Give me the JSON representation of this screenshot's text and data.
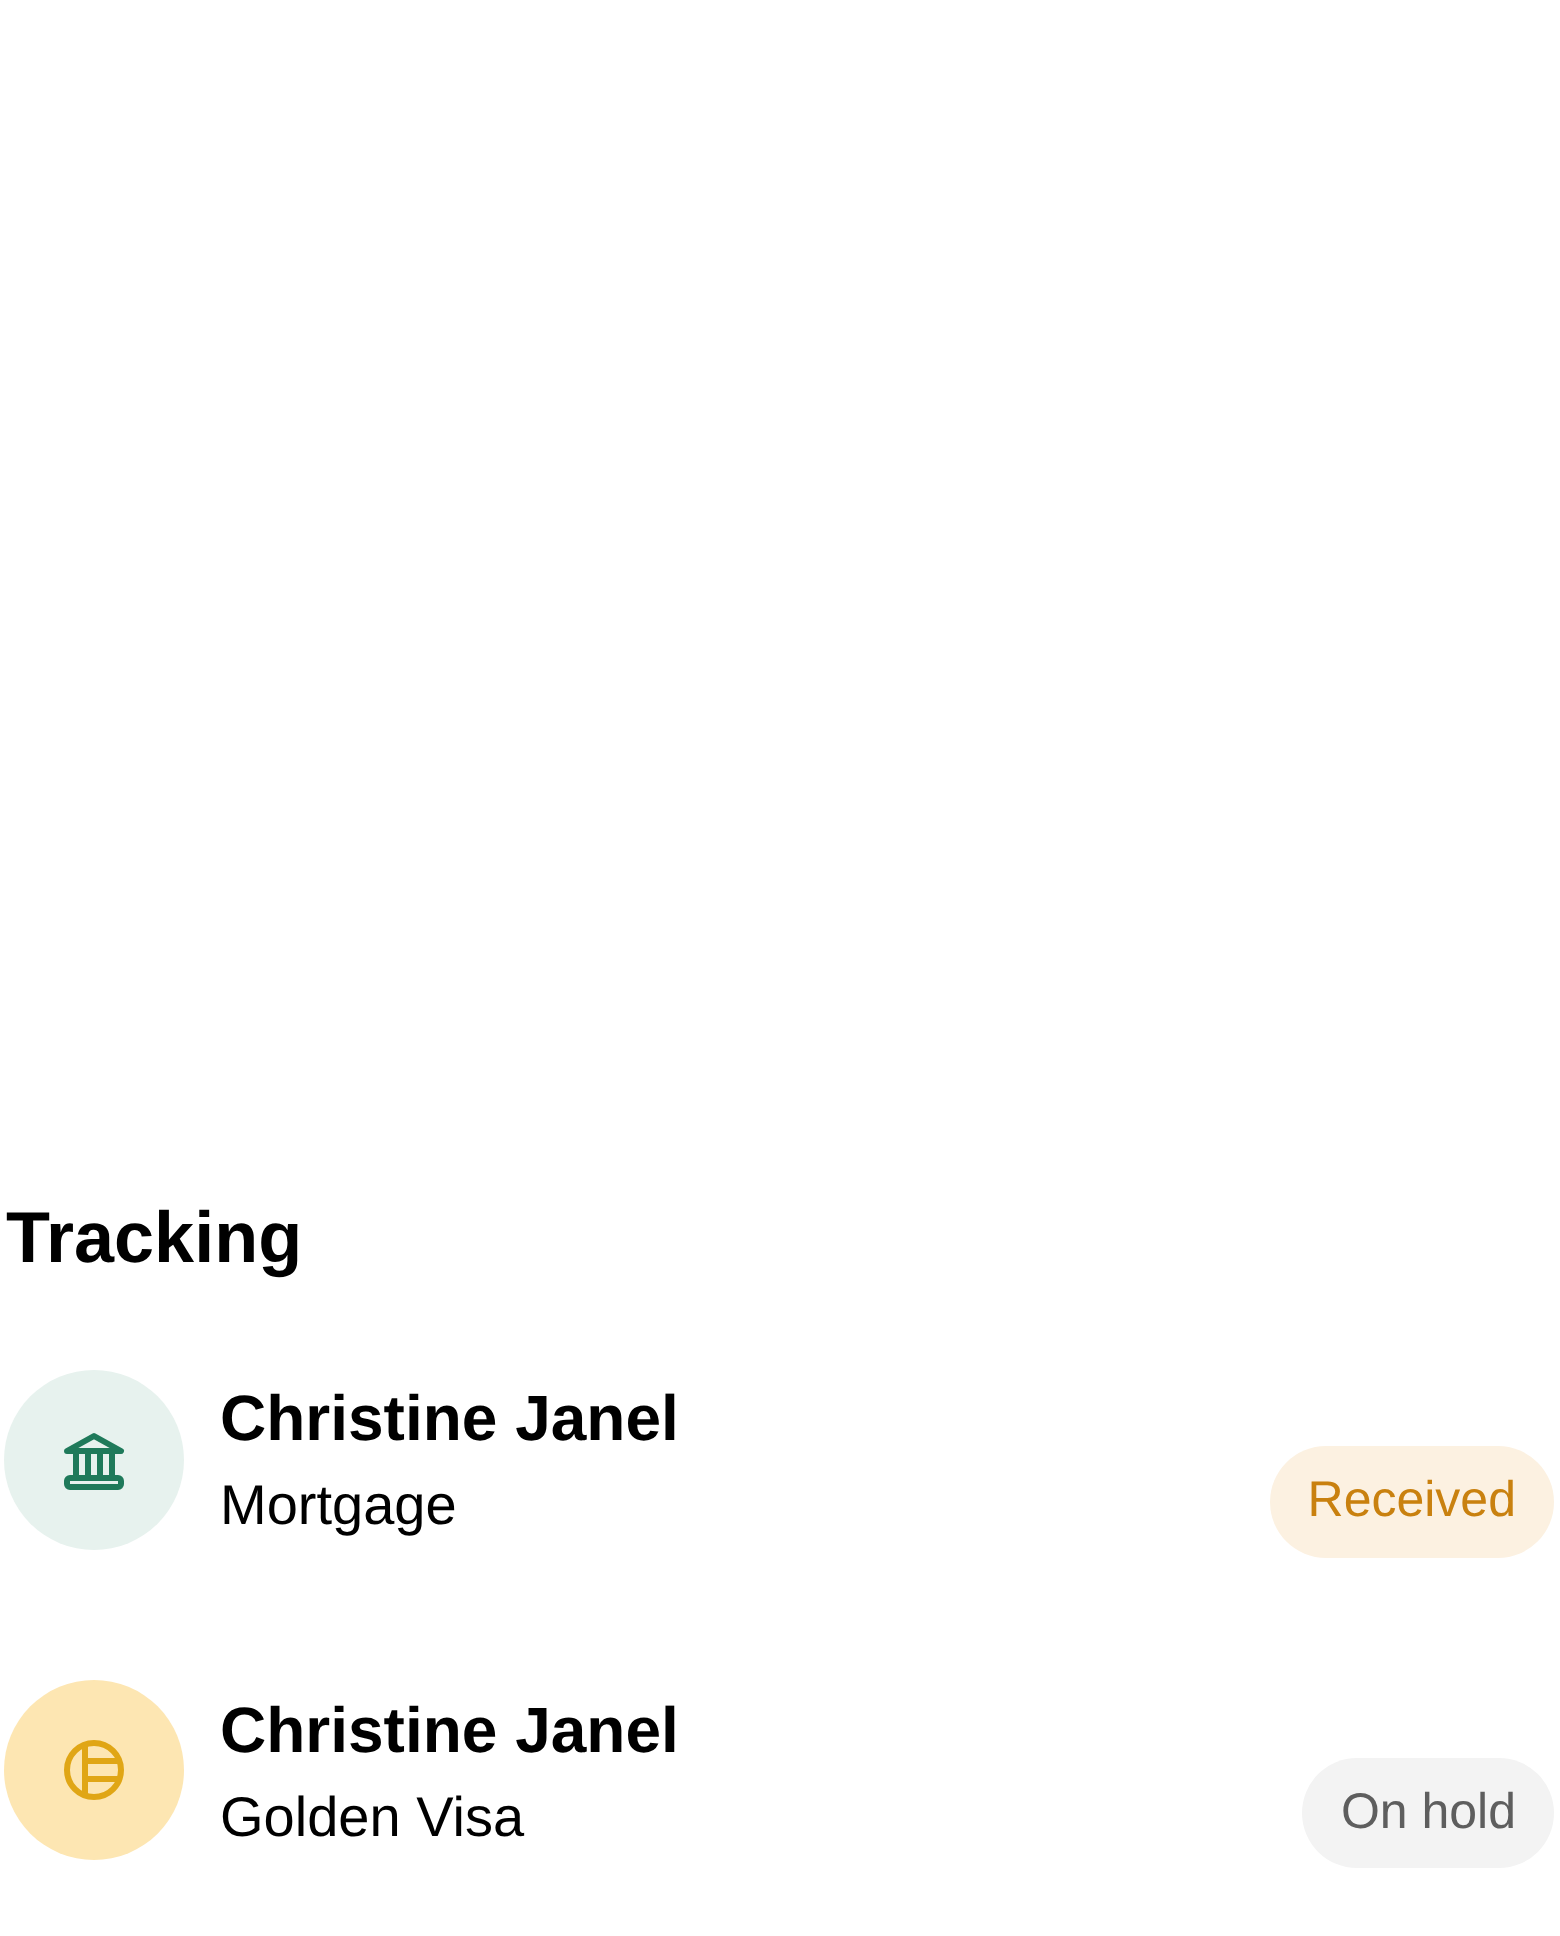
{
  "section_title": "Tracking",
  "items": [
    {
      "kind": "mortgage",
      "name": "Christine Janel",
      "service": "Mortgage",
      "status": {
        "kind": "received",
        "label": "Received"
      }
    },
    {
      "kind": "visa",
      "name": "Christine Janel",
      "service": "Golden Visa",
      "status": {
        "kind": "on_hold",
        "label": "On hold"
      }
    }
  ]
}
